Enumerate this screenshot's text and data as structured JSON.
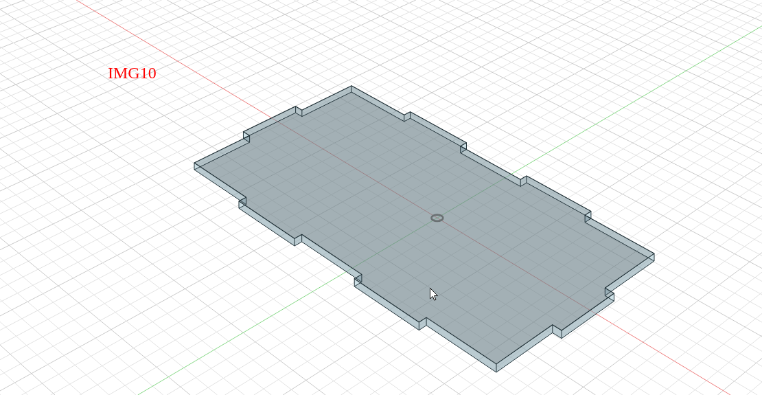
{
  "viewport": {
    "label": "IMG10"
  }
}
